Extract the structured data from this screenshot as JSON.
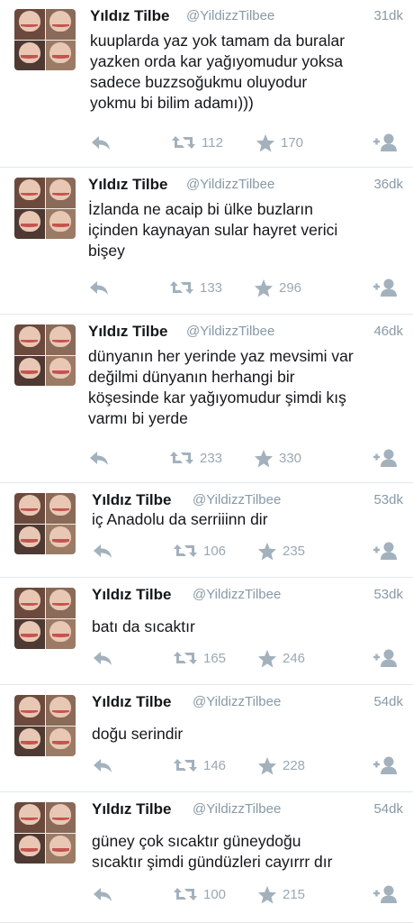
{
  "tweets": [
    {
      "name": "Yıldız Tilbe",
      "handle": "@YildizzTilbee",
      "time": "31dk",
      "text": "kuuplarda yaz yok tamam da buralar\nyazken orda kar yağıyomudur yoksa\nsadece buzzsoğukmu oluyodur\nyokmu bi bilim adamı)))",
      "retweets": "112",
      "favorites": "170"
    },
    {
      "name": "Yıldız Tilbe",
      "handle": "@YildizzTilbee",
      "time": "36dk",
      "text": "İzlanda ne acaip bi ülke buzların\niçinden kaynayan sular hayret verici\nbişey",
      "retweets": "133",
      "favorites": "296"
    },
    {
      "name": "Yıldız Tilbe",
      "handle": "@YildizzTilbee",
      "time": "46dk",
      "text": "dünyanın her yerinde yaz mevsimi var\ndeğilmi  dünyanın herhangi bir\nköşesinde kar yağıyomudur şimdi kış\nvarmı bi yerde",
      "retweets": "233",
      "favorites": "330"
    },
    {
      "name": "Yıldız Tilbe",
      "handle": "@YildizzTilbee",
      "time": "53dk",
      "text": "iç Anadolu da serriiinn dir",
      "retweets": "106",
      "favorites": "235"
    },
    {
      "name": "Yıldız Tilbe",
      "handle": "@YildizzTilbee",
      "time": "53dk",
      "text": "batı da sıcaktır",
      "retweets": "165",
      "favorites": "246"
    },
    {
      "name": "Yıldız Tilbe",
      "handle": "@YildizzTilbee",
      "time": "54dk",
      "text": "doğu serindir",
      "retweets": "146",
      "favorites": "228"
    },
    {
      "name": "Yıldız Tilbe",
      "handle": "@YildizzTilbee",
      "time": "54dk",
      "text": "güney  çok sıcaktır güneydoğu\nsıcaktır şimdi gündüzleri cayırrr dır",
      "retweets": "100",
      "favorites": "215"
    }
  ],
  "icons": {
    "reply": "reply-icon",
    "retweet": "retweet-icon",
    "favorite": "star-icon",
    "follow": "follow-icon"
  },
  "colors": {
    "text": "#14171a",
    "muted": "#8899a6",
    "icon": "#9aa8b4",
    "divider": "#e1e8ed"
  }
}
